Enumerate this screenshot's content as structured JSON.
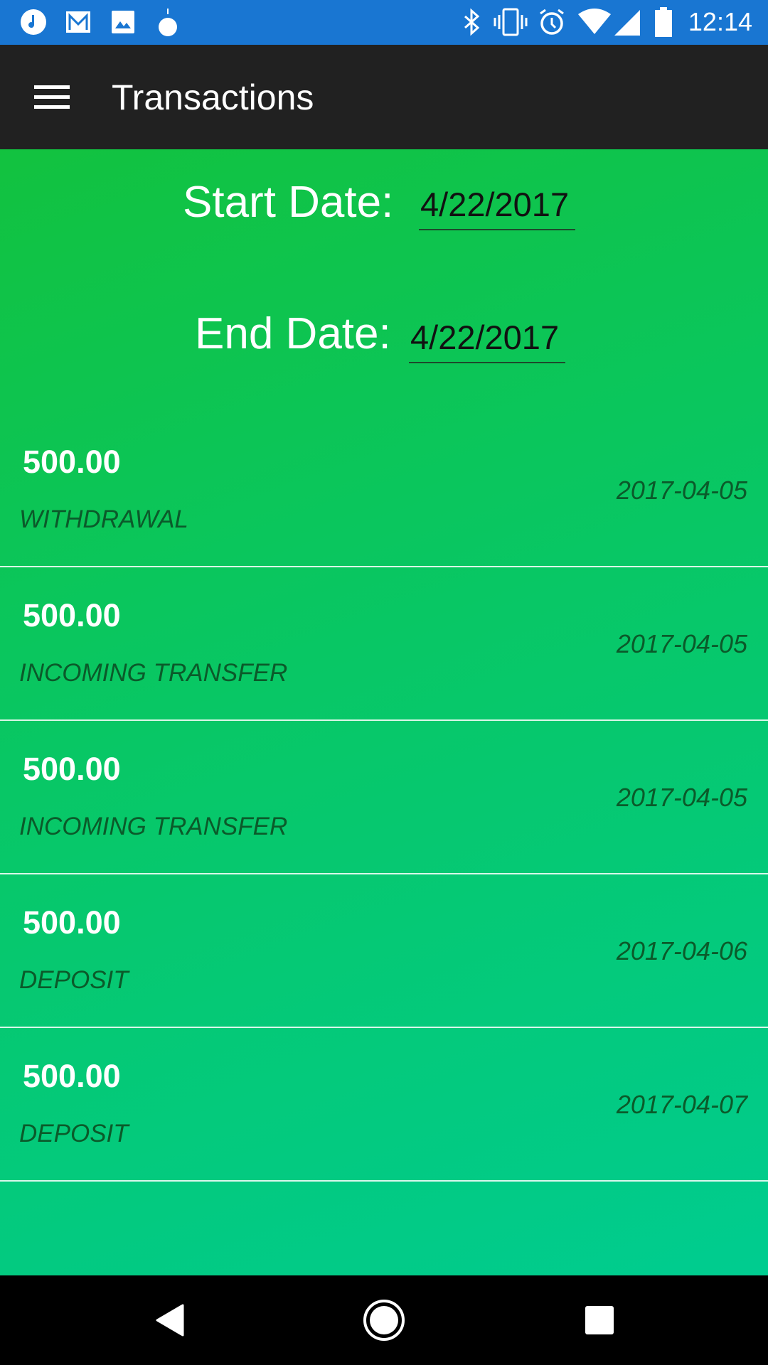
{
  "status_bar": {
    "time": "12:14",
    "icons": [
      "music-icon",
      "gmail-icon",
      "photos-icon",
      "fruit-app-icon",
      "bluetooth-icon",
      "vibrate-icon",
      "alarm-icon",
      "wifi-icon",
      "signal-icon",
      "battery-icon"
    ]
  },
  "toolbar": {
    "title": "Transactions",
    "menu_icon": "hamburger-menu-icon"
  },
  "filters": {
    "start_label": "Start Date:",
    "start_value": "4/22/2017",
    "end_label": "End Date:",
    "end_value": "4/22/2017"
  },
  "transactions": [
    {
      "amount": "500.00",
      "type": "WITHDRAWAL",
      "date": "2017-04-05"
    },
    {
      "amount": "500.00",
      "type": "INCOMING TRANSFER",
      "date": "2017-04-05"
    },
    {
      "amount": "500.00",
      "type": "INCOMING TRANSFER",
      "date": "2017-04-05"
    },
    {
      "amount": "500.00",
      "type": "DEPOSIT",
      "date": "2017-04-06"
    },
    {
      "amount": "500.00",
      "type": "DEPOSIT",
      "date": "2017-04-07"
    }
  ],
  "colors": {
    "status_bar": "#1976d2",
    "toolbar": "#212121",
    "gradient_start": "#12c23f",
    "gradient_end": "#00cc90",
    "secondary_text": "#0b5a2a"
  }
}
